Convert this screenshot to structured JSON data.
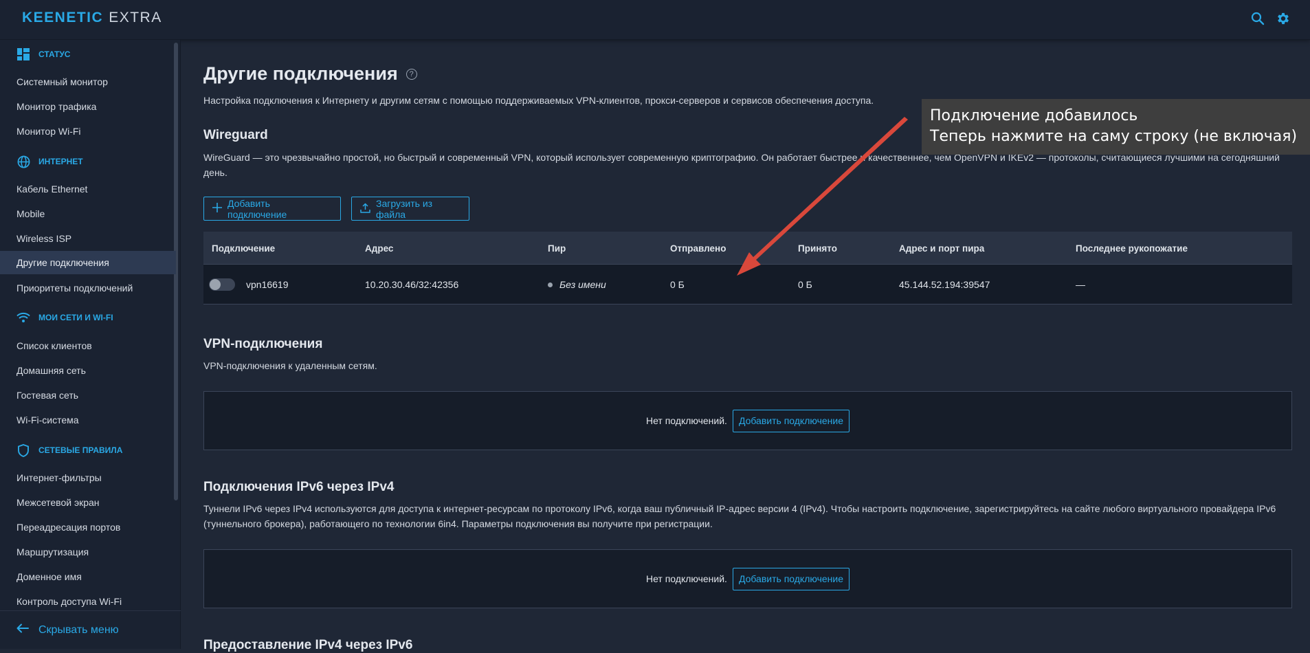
{
  "brand": {
    "name": "KEENETIC",
    "model": "EXTRA"
  },
  "sidebar": {
    "sections": [
      {
        "title": "СТАТУС",
        "icon": "dashboard-icon",
        "items": [
          "Системный монитор",
          "Монитор трафика",
          "Монитор Wi-Fi"
        ]
      },
      {
        "title": "ИНТЕРНЕТ",
        "icon": "globe-icon",
        "items": [
          "Кабель Ethernet",
          "Mobile",
          "Wireless ISP",
          "Другие подключения",
          "Приоритеты подключений"
        ]
      },
      {
        "title": "МОИ СЕТИ И WI-FI",
        "icon": "wifi-icon",
        "items": [
          "Список клиентов",
          "Домашняя сеть",
          "Гостевая сеть",
          "Wi-Fi-система"
        ]
      },
      {
        "title": "СЕТЕВЫЕ ПРАВИЛА",
        "icon": "shield-icon",
        "items": [
          "Интернет-фильтры",
          "Межсетевой экран",
          "Переадресация портов",
          "Маршрутизация",
          "Доменное имя",
          "Контроль доступа Wi-Fi"
        ]
      }
    ],
    "active_item": "Другие подключения",
    "collapse_label": "Скрывать меню"
  },
  "main": {
    "title": "Другие подключения",
    "subtitle": "Настройка подключения к Интернету и другим сетям с помощью поддерживаемых VPN-клиентов, прокси-серверов и сервисов обеспечения доступа.",
    "wireguard": {
      "title": "Wireguard",
      "description": "WireGuard — это чрезвычайно простой, но быстрый и современный VPN, который использует современную криптографию. Он работает быстрее и качественнее, чем OpenVPN и IKEv2 — протоколы, считающиеся лучшими на сегодняшний день.",
      "add_button": "Добавить подключение",
      "upload_button": "Загрузить из файла",
      "columns": [
        "Подключение",
        "Адрес",
        "Пир",
        "Отправлено",
        "Принято",
        "Адрес и порт пира",
        "Последнее рукопожатие"
      ],
      "rows": [
        {
          "enabled": false,
          "name": "vpn16619",
          "address": "10.20.30.46/32:42356",
          "peer": "Без имени",
          "sent": "0 Б",
          "received": "0 Б",
          "peer_endpoint": "45.144.52.194:39547",
          "last_handshake": "—"
        }
      ]
    },
    "vpn": {
      "title": "VPN-подключения",
      "description": "VPN-подключения к удаленным сетям.",
      "empty_text": "Нет подключений.",
      "add_button": "Добавить подключение"
    },
    "ipv6": {
      "title": "Подключения IPv6 через IPv4",
      "description": "Туннели IPv6 через IPv4 используются для доступа к интернет-ресурсам по протоколу IPv6, когда ваш публичный IP-адрес версии 4 (IPv4). Чтобы настроить подключение, зарегистрируйтесь на сайте любого виртуального провайдера IPv6 (туннельного брокера), работающего по технологии 6in4. Параметры подключения вы получите при регистрации.",
      "empty_text": "Нет подключений.",
      "add_button": "Добавить подключение"
    },
    "ipv4_over_ipv6": {
      "title": "Предоставление IPv4 через IPv6"
    }
  },
  "hint": {
    "line1": "Подключение добавилось",
    "line2": "Теперь нажмите на саму строку (не включая)"
  },
  "colors": {
    "accent": "#2aa9e6",
    "background": "#1f2736",
    "sidebar": "#1a2231",
    "arrow": "#d9483b"
  }
}
